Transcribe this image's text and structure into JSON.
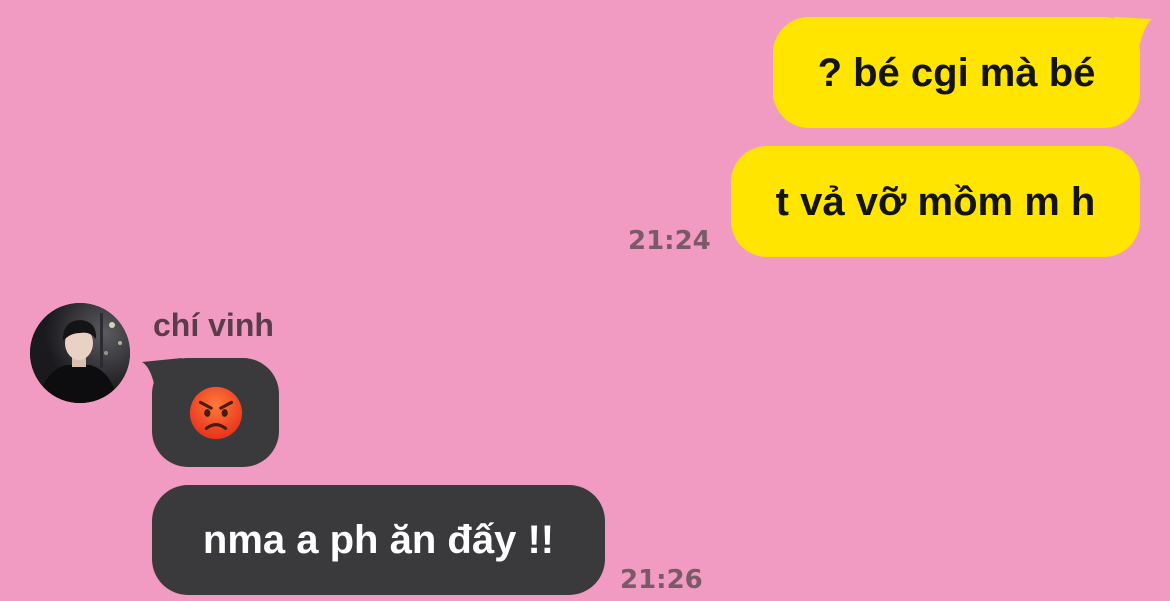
{
  "conversation": {
    "outgoing": [
      {
        "text": "? bé cgi mà bé"
      },
      {
        "text": "t vả vỡ mồm m h"
      }
    ],
    "outgoing_time": "21:24",
    "contact": {
      "name": "chí vinh"
    },
    "incoming": [
      {
        "emoji": "pouting-face-emoji"
      },
      {
        "text": "nma a ph ăn đấy !!"
      }
    ],
    "incoming_time": "21:26"
  },
  "colors": {
    "background": "#f29bc2",
    "outgoing_bubble": "#ffe500",
    "incoming_bubble": "#3a3a3c",
    "timestamp": "#7a5a69",
    "sender_name": "#5b3c4a"
  }
}
